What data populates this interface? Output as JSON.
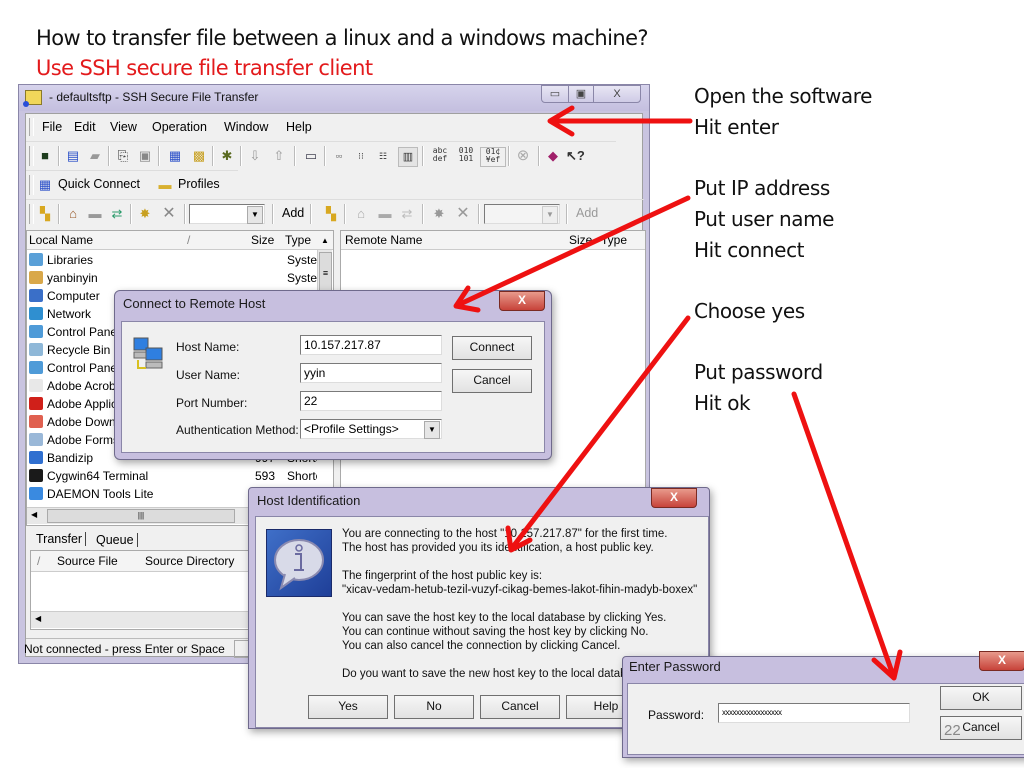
{
  "slide": {
    "title": "How to transfer file between a linux and a windows machine?",
    "subtitle": "Use SSH secure file transfer client",
    "page_number": "22",
    "accent_color": "#e31a1c",
    "steps": [
      {
        "lines": [
          "Open the software",
          "Hit enter"
        ]
      },
      {
        "lines": [
          "Put IP address",
          "Put user name",
          "Hit connect"
        ]
      },
      {
        "lines": [
          "Choose yes"
        ]
      },
      {
        "lines": [
          "Put password",
          "Hit ok"
        ]
      }
    ]
  },
  "main_window": {
    "title": "- defaultsftp - SSH Secure File Transfer",
    "controls": {
      "minimize": "▭",
      "maximize": "▣",
      "close": "X"
    },
    "menu": [
      "File",
      "Edit",
      "View",
      "Operation",
      "Window",
      "Help"
    ],
    "quick_connect": "Quick Connect",
    "profiles": "Profiles",
    "add_left": "Add",
    "add_right": "Add",
    "toolbar_text_icons": [
      "abc def",
      "010 101",
      "01¢ ¥ef"
    ],
    "local_pane": {
      "columns": [
        "Local Name",
        "/",
        "Size",
        "Type"
      ],
      "items": [
        {
          "name": "Libraries",
          "size": "",
          "type": "Syster",
          "icon": "libraries-icon",
          "color": "#5aa0d8"
        },
        {
          "name": "yanbinyin",
          "size": "",
          "type": "Syster",
          "icon": "user-folder-icon",
          "color": "#d9a84a"
        },
        {
          "name": "Computer",
          "size": "",
          "type": "",
          "icon": "computer-icon",
          "color": "#3a6fc8"
        },
        {
          "name": "Network",
          "size": "",
          "type": "",
          "icon": "network-icon",
          "color": "#2f8fd0"
        },
        {
          "name": "Control Pane",
          "size": "",
          "type": "",
          "icon": "control-panel-icon",
          "color": "#4f9bd8"
        },
        {
          "name": "Recycle Bin",
          "size": "",
          "type": "",
          "icon": "recycle-bin-icon",
          "color": "#8fb8d8"
        },
        {
          "name": "Control Pane",
          "size": "",
          "type": "",
          "icon": "control-panel-icon",
          "color": "#4f9bd8"
        },
        {
          "name": "Adobe Acrob",
          "size": "",
          "type": "",
          "icon": "adobe-acrobat-icon",
          "color": "#e8e8e8"
        },
        {
          "name": "Adobe Applic",
          "size": "",
          "type": "",
          "icon": "adobe-app-icon",
          "color": "#d0201a"
        },
        {
          "name": "Adobe Down",
          "size": "",
          "type": "",
          "icon": "adobe-download-icon",
          "color": "#e06050"
        },
        {
          "name": "Adobe Forms",
          "size": "",
          "type": "",
          "icon": "adobe-forms-icon",
          "color": "#9ab8d8"
        },
        {
          "name": "Bandizip",
          "size": "997",
          "type": "Shortc",
          "icon": "bandizip-icon",
          "color": "#2f6fd0"
        },
        {
          "name": "Cygwin64 Terminal",
          "size": "593",
          "type": "Shortc",
          "icon": "cygwin-icon",
          "color": "#1a1a1a"
        },
        {
          "name": "DAEMON Tools Lite",
          "size": "",
          "type": "",
          "icon": "daemon-tools-icon",
          "color": "#3a8ae0"
        }
      ]
    },
    "remote_pane": {
      "columns": [
        "Remote Name",
        "Size",
        "Type"
      ]
    },
    "transfer_tabs": [
      "Transfer",
      "Queue"
    ],
    "transfer_columns": [
      "/",
      "Source File",
      "Source Directory"
    ],
    "status": "Not connected - press Enter or Space"
  },
  "connect_dialog": {
    "title": "Connect to Remote Host",
    "close": "X",
    "host_label": "Host Name:",
    "host_value": "10.157.217.87",
    "user_label": "User Name:",
    "user_value": "yyin",
    "port_label": "Port Number:",
    "port_value": "22",
    "auth_label": "Authentication Method:",
    "auth_value": "<Profile Settings>",
    "connect_button": "Connect",
    "cancel_button": "Cancel"
  },
  "host_id_dialog": {
    "title": "Host Identification",
    "close": "X",
    "lines": [
      "You are connecting to the host \"10.157.217.87\" for the first time.",
      "The host has provided you its identification, a host public key.",
      "",
      "The fingerprint of the host public key is:",
      "\"xicav-vedam-hetub-tezil-vuzyf-cikag-bemes-lakot-fihin-madyb-boxex\"",
      "",
      "You can save the host key to the local database by clicking Yes.",
      "You can continue without saving the host key by clicking No.",
      "You can also cancel the connection by clicking Cancel.",
      "",
      "Do you want to save the new host key to the local database?"
    ],
    "buttons": [
      "Yes",
      "No",
      "Cancel",
      "Help"
    ]
  },
  "password_dialog": {
    "title": "Enter Password",
    "close": "X",
    "label": "Password:",
    "value": "xxxxxxxxxxxxxxxxx",
    "ok_button": "OK",
    "cancel_button": "Cancel"
  }
}
